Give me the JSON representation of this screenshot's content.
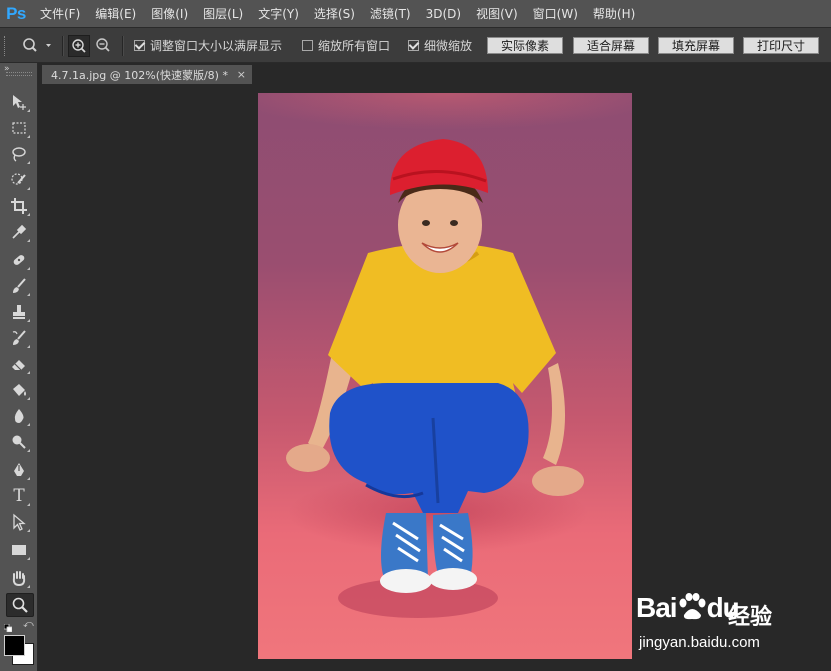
{
  "app": {
    "logo": "Ps"
  },
  "menu": [
    "文件(F)",
    "编辑(E)",
    "图像(I)",
    "图层(L)",
    "文字(Y)",
    "选择(S)",
    "滤镜(T)",
    "3D(D)",
    "视图(V)",
    "窗口(W)",
    "帮助(H)"
  ],
  "options": {
    "tool_icon": "zoom-icon",
    "resize_windows": {
      "label": "调整窗口大小以满屏显示",
      "checked": true
    },
    "zoom_all_windows": {
      "label": "缩放所有窗口",
      "checked": false
    },
    "scrubby_zoom": {
      "label": "细微缩放",
      "checked": true
    },
    "buttons": [
      "实际像素",
      "适合屏幕",
      "填充屏幕",
      "打印尺寸"
    ]
  },
  "document": {
    "tab_title": "4.7.1a.jpg @ 102%(快速蒙版/8) *",
    "close": "×"
  },
  "tools": [
    "move-icon",
    "marquee-icon",
    "lasso-icon",
    "quick-selection-icon",
    "crop-icon",
    "eyedropper-icon",
    "healing-brush-icon",
    "brush-icon",
    "clone-stamp-icon",
    "history-brush-icon",
    "eraser-icon",
    "paint-bucket-icon",
    "blur-icon",
    "dodge-icon",
    "pen-icon",
    "type-icon",
    "path-selection-icon",
    "rectangle-icon",
    "hand-icon",
    "zoom-icon"
  ],
  "colors": {
    "foreground": "#000000",
    "background": "#ffffff",
    "canvas_top": "#8e4d72",
    "canvas_bottom": "#f0767c"
  },
  "watermark": {
    "logo": "Bai",
    "logo_end": "du",
    "name": "经验",
    "url": "jingyan.baidu.com"
  }
}
